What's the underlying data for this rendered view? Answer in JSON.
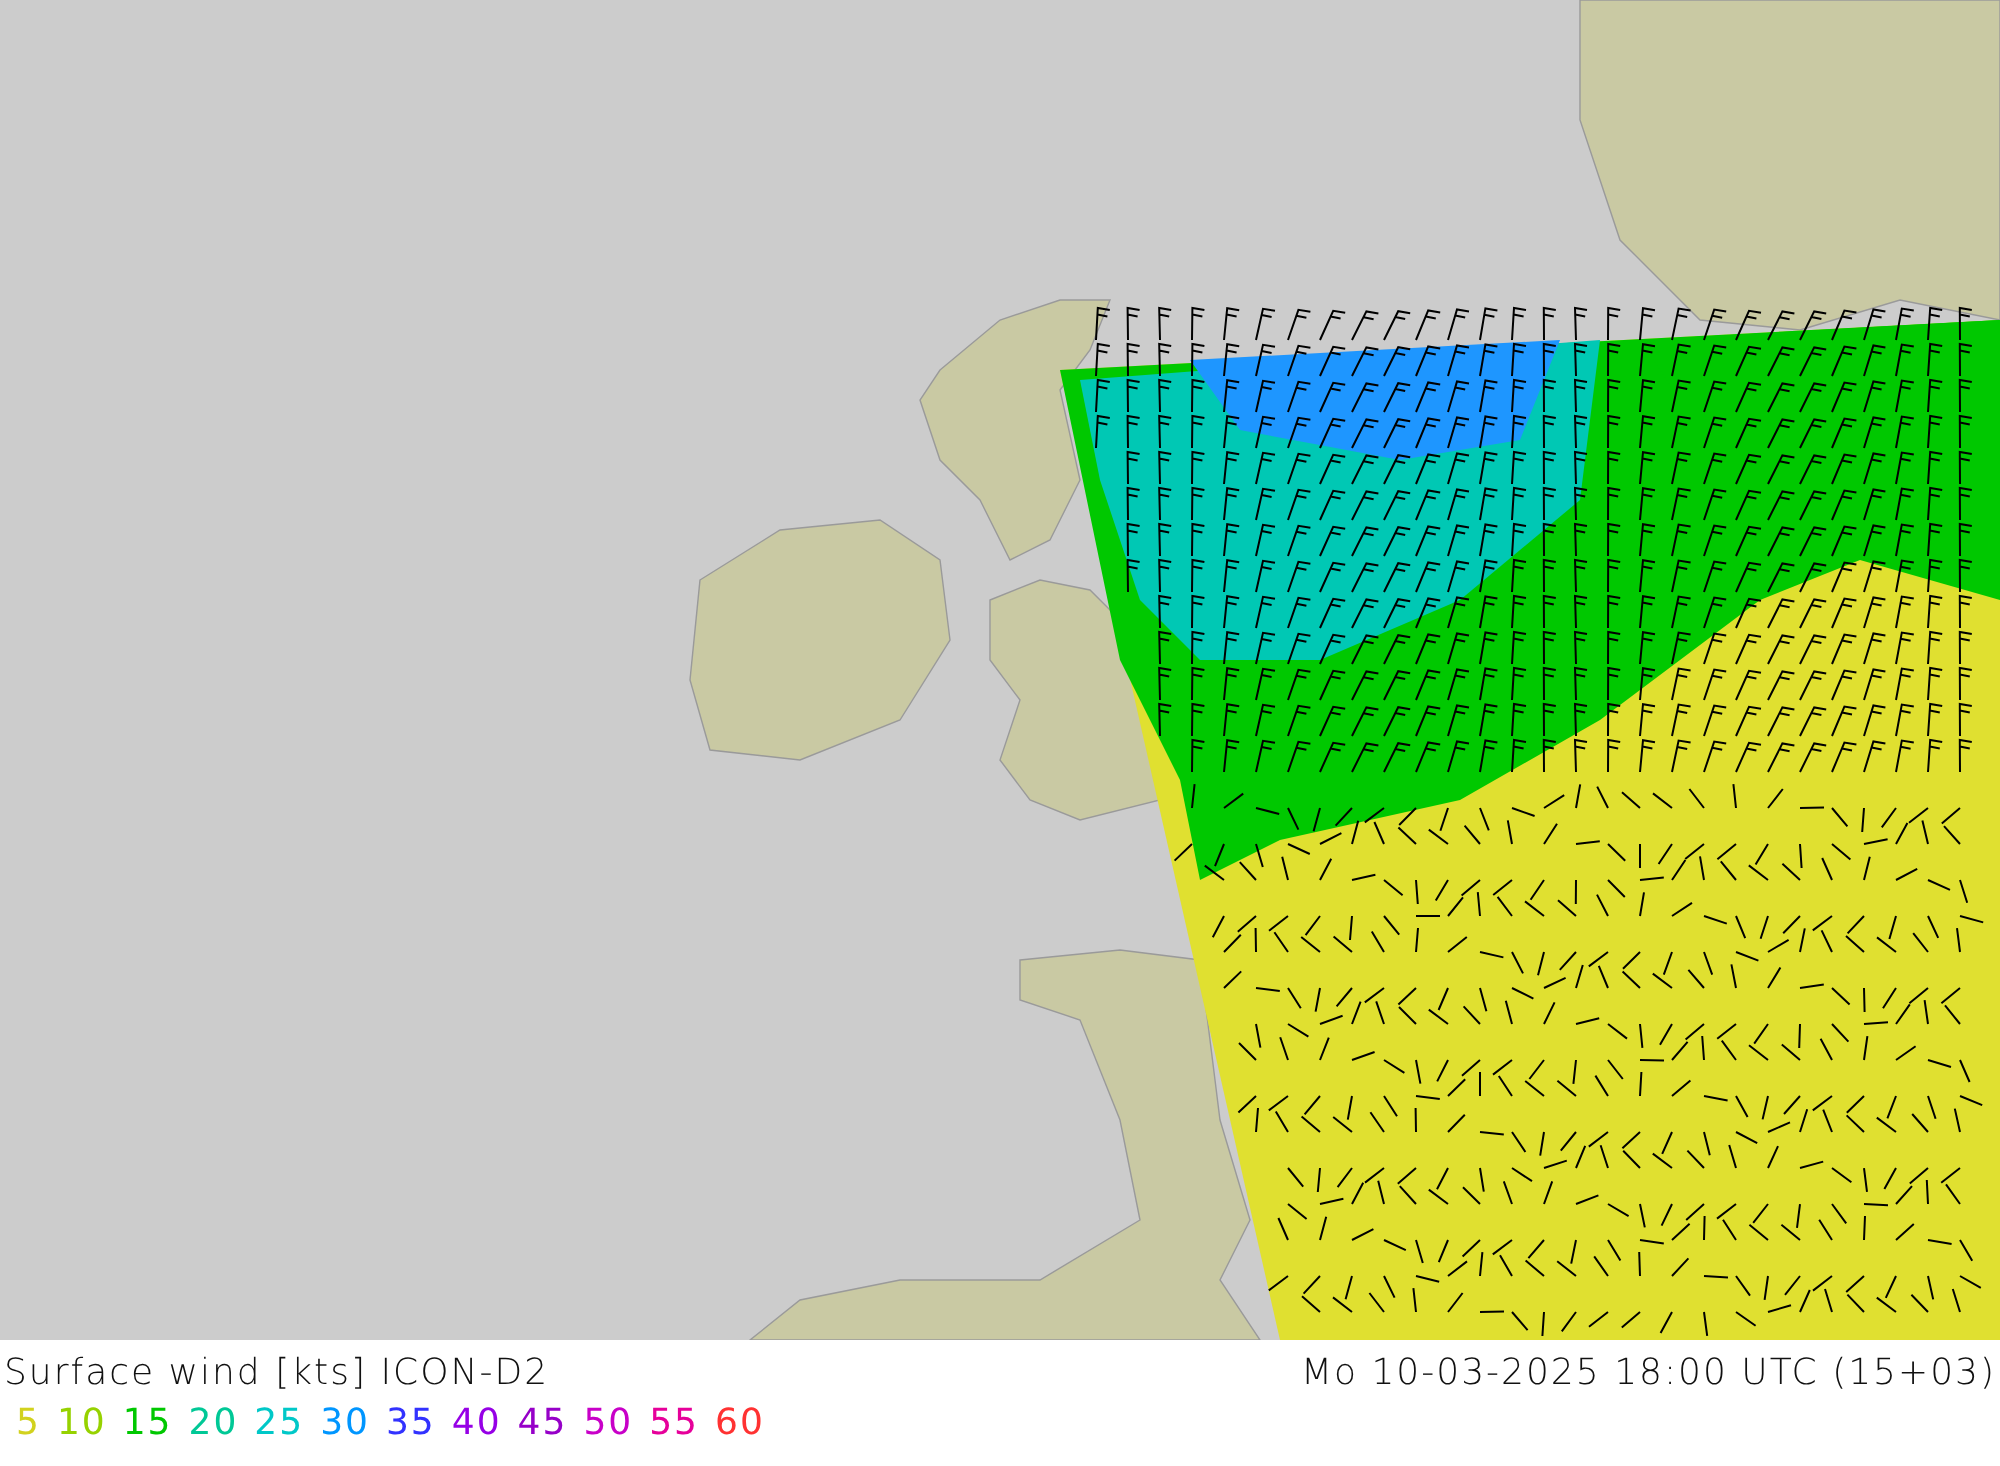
{
  "title": "Surface wind [kts] ICON-D2",
  "valid_time": "Mo 10-03-2025 18:00 UTC (15+03)",
  "legend": [
    {
      "label": "5",
      "color": "#d2d21e"
    },
    {
      "label": "10",
      "color": "#96d200"
    },
    {
      "label": "15",
      "color": "#00c800"
    },
    {
      "label": "20",
      "color": "#00c896"
    },
    {
      "label": "25",
      "color": "#00c8c8"
    },
    {
      "label": "30",
      "color": "#0096ff"
    },
    {
      "label": "35",
      "color": "#3232ff"
    },
    {
      "label": "40",
      "color": "#9600e6"
    },
    {
      "label": "45",
      "color": "#9600c8"
    },
    {
      "label": "50",
      "color": "#c800c8"
    },
    {
      "label": "55",
      "color": "#e6009a"
    },
    {
      "label": "60",
      "color": "#ff3232"
    }
  ]
}
